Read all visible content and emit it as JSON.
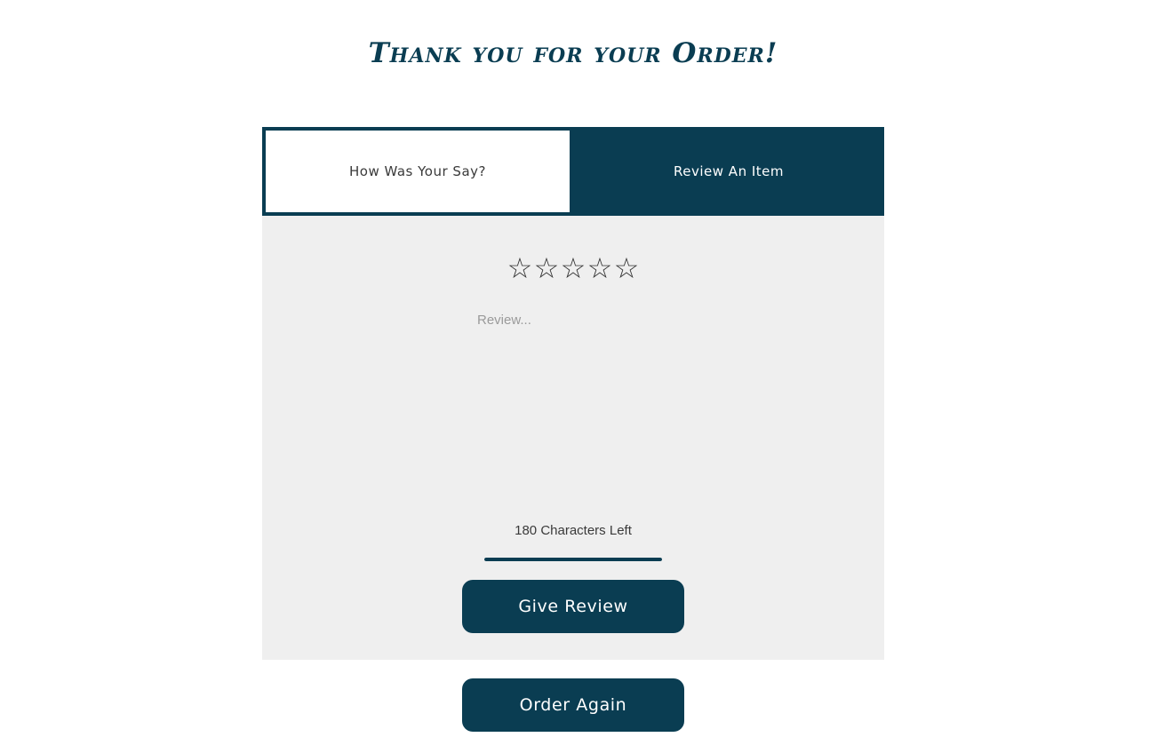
{
  "page": {
    "title": "Thank you for your Order!"
  },
  "tabs": [
    {
      "label": "How Was Your Say?",
      "active": true
    },
    {
      "label": "Review An Item",
      "active": false
    }
  ],
  "rating": {
    "max": 5,
    "value": 0,
    "star_glyph": "☆"
  },
  "review": {
    "placeholder": "Review...",
    "value": ""
  },
  "char_counter": {
    "text": "180 Characters Left",
    "remaining": 180,
    "max": 180
  },
  "buttons": {
    "give_review": "Give Review",
    "order_again": "Order Again"
  },
  "colors": {
    "primary": "#0a3d52",
    "panel_background": "#efefef",
    "page_background": "#ffffff"
  }
}
